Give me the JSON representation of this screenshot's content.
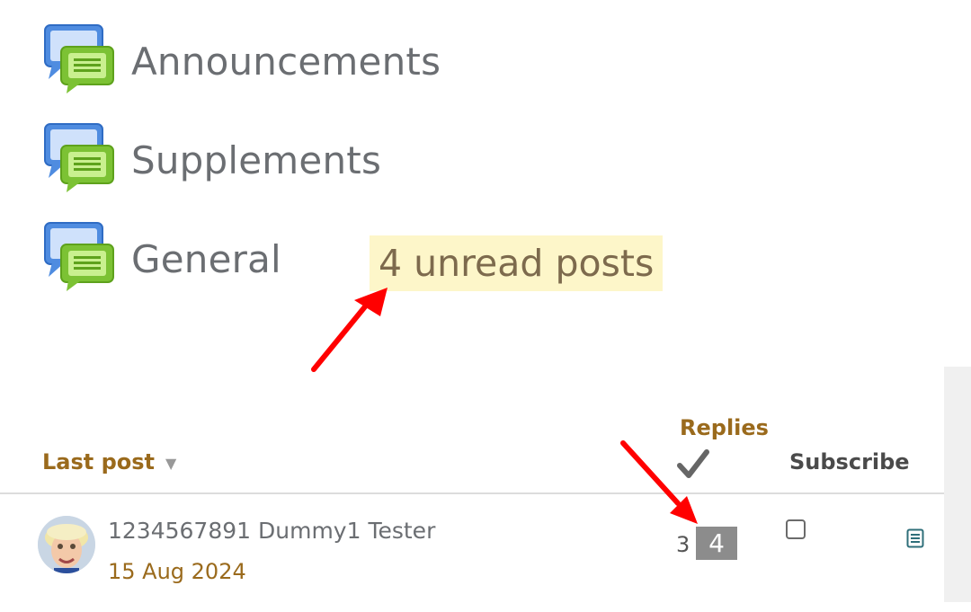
{
  "forums": [
    {
      "name": "Announcements",
      "icon": "forum-icon"
    },
    {
      "name": "Supplements",
      "icon": "forum-icon"
    },
    {
      "name": "General",
      "icon": "forum-icon"
    }
  ],
  "general_unread": "4 unread posts",
  "table": {
    "headers": {
      "last_post": "Last post",
      "replies": "Replies",
      "subscribe": "Subscribe"
    },
    "row": {
      "author": "1234567891 Dummy1 Tester",
      "date": "15 Aug 2024",
      "replies": "3",
      "unread": "4",
      "subscribed": false
    }
  },
  "colors": {
    "accent": "#9a6a1c",
    "highlight": "#fdf6c9",
    "annotation": "#ff0000",
    "badge": "#8c8c8c"
  }
}
